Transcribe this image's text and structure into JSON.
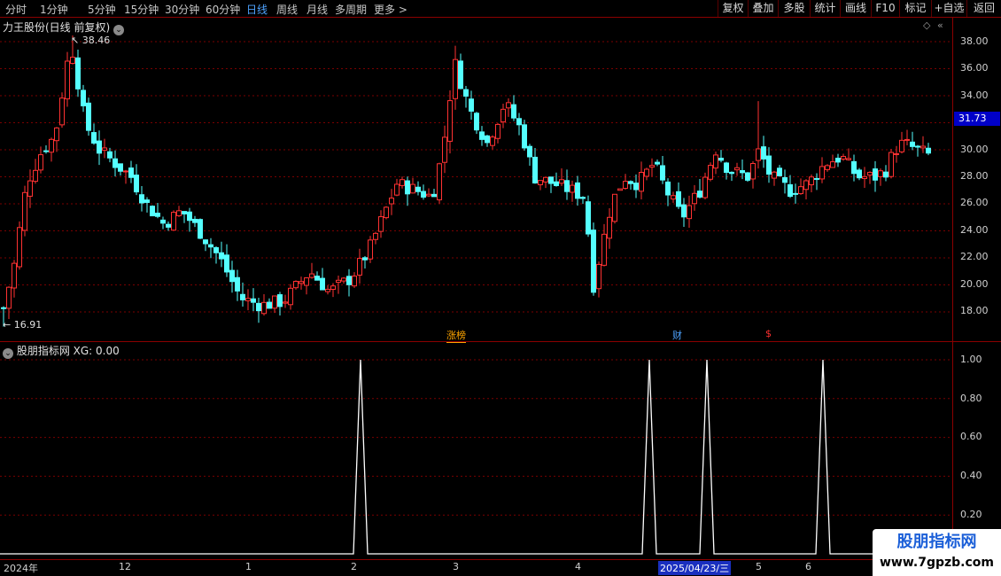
{
  "toolbar": {
    "periods": [
      "分时",
      "1分钟",
      "5分钟",
      "15分钟",
      "30分钟",
      "60分钟",
      "日线",
      "周线",
      "月线",
      "多周期",
      "更多"
    ],
    "active_period": "日线",
    "more_arrow": ">",
    "right_buttons": [
      "复权",
      "叠加",
      "多股",
      "统计",
      "画线",
      "F10",
      "标记",
      "+自选",
      "返回"
    ]
  },
  "main_panel": {
    "title": "力王股份(日线 前复权)",
    "high_label": "38.46",
    "low_label": "16.91",
    "current_price": "31.73",
    "y_labels": [
      "38.00",
      "36.00",
      "34.00",
      "32.00",
      "30.00",
      "28.00",
      "26.00",
      "24.00",
      "22.00",
      "20.00",
      "18.00"
    ],
    "markers": [
      {
        "text": "涨榜",
        "color": "#ffa500"
      },
      {
        "text": "财",
        "color": "#4ea3ff"
      },
      {
        "text": "$",
        "color": "#ff3030"
      }
    ]
  },
  "sub_panel": {
    "title": "股朋指标网 XG: 0.00",
    "y_labels": [
      "1.00",
      "0.80",
      "0.60",
      "0.40",
      "0.20"
    ]
  },
  "time_axis": {
    "labels": [
      "2024年",
      "12",
      "1",
      "2",
      "3",
      "4",
      "2025/04/23/三",
      "5",
      "6"
    ]
  },
  "watermark": {
    "title": "股朋指标网",
    "url": "www.7gpzb.com"
  },
  "colors": {
    "up": "#ff3232",
    "down": "#54ffff",
    "grid": "#7a0000",
    "signal": "#ffffff"
  },
  "chart_data": {
    "type": "candlestick",
    "ylim": [
      16.5,
      39.0
    ],
    "price_path": [
      [
        0,
        17.2
      ],
      [
        16,
        21.5
      ],
      [
        30,
        27.5
      ],
      [
        48,
        30.0
      ],
      [
        62,
        31.0
      ],
      [
        80,
        38.0
      ],
      [
        96,
        32.0
      ],
      [
        112,
        30.0
      ],
      [
        130,
        29.0
      ],
      [
        148,
        28.0
      ],
      [
        165,
        26.0
      ],
      [
        185,
        24.5
      ],
      [
        205,
        25.5
      ],
      [
        225,
        24.0
      ],
      [
        248,
        22.0
      ],
      [
        272,
        19.0
      ],
      [
        296,
        18.5
      ],
      [
        320,
        18.8
      ],
      [
        350,
        21.0
      ],
      [
        372,
        19.5
      ],
      [
        396,
        20.5
      ],
      [
        416,
        22.5
      ],
      [
        432,
        25.0
      ],
      [
        448,
        27.5
      ],
      [
        470,
        27.0
      ],
      [
        488,
        26.5
      ],
      [
        500,
        30.0
      ],
      [
        513,
        36.5
      ],
      [
        530,
        33.0
      ],
      [
        550,
        30.5
      ],
      [
        570,
        33.5
      ],
      [
        588,
        31.5
      ],
      [
        603,
        28.0
      ],
      [
        625,
        27.5
      ],
      [
        645,
        27.0
      ],
      [
        660,
        26.5
      ],
      [
        670,
        20.0
      ],
      [
        690,
        26.0
      ],
      [
        705,
        28.0
      ],
      [
        720,
        27.5
      ],
      [
        738,
        29.0
      ],
      [
        752,
        27.0
      ],
      [
        770,
        25.0
      ],
      [
        790,
        27.0
      ],
      [
        808,
        30.0
      ],
      [
        823,
        28.5
      ],
      [
        845,
        28.0
      ],
      [
        857,
        30.0
      ],
      [
        870,
        28.0
      ],
      [
        892,
        27.0
      ],
      [
        912,
        27.5
      ],
      [
        932,
        29.0
      ],
      [
        950,
        29.5
      ],
      [
        968,
        28.0
      ],
      [
        988,
        28.0
      ],
      [
        1000,
        28.5
      ],
      [
        1010,
        30.0
      ],
      [
        1020,
        30.5
      ],
      [
        1035,
        30.0
      ],
      [
        1052,
        29.5
      ]
    ],
    "high": {
      "x": 80,
      "value": 38.46
    },
    "low": {
      "x": 4,
      "value": 16.91
    },
    "current": 31.73,
    "signals": {
      "ylim": [
        0,
        1.05
      ],
      "values": [
        1,
        1,
        1,
        1
      ],
      "x": [
        407,
        733,
        798,
        929
      ]
    }
  }
}
